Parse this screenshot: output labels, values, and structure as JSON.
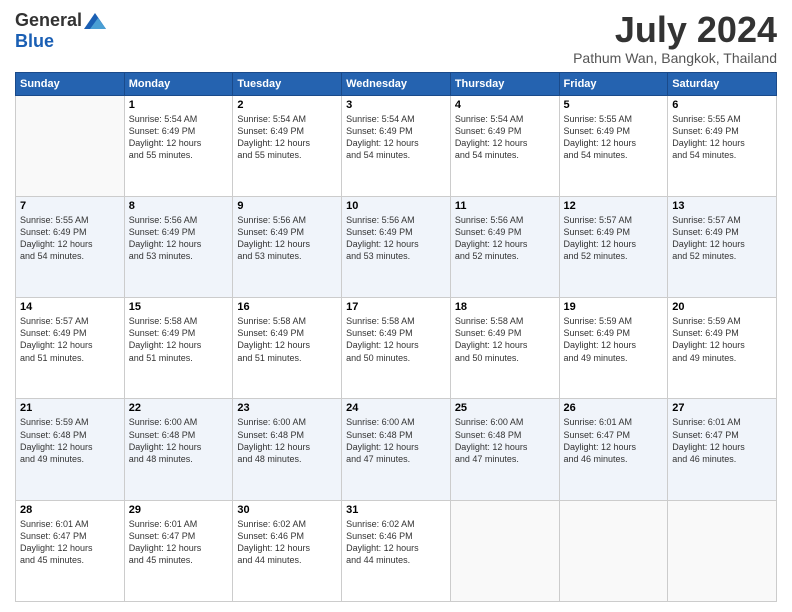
{
  "header": {
    "logo_general": "General",
    "logo_blue": "Blue",
    "title": "July 2024",
    "location": "Pathum Wan, Bangkok, Thailand"
  },
  "days_of_week": [
    "Sunday",
    "Monday",
    "Tuesday",
    "Wednesday",
    "Thursday",
    "Friday",
    "Saturday"
  ],
  "weeks": [
    [
      {
        "num": "",
        "empty": true
      },
      {
        "num": "1",
        "sunrise": "5:54 AM",
        "sunset": "6:49 PM",
        "daylight": "12 hours and 55 minutes."
      },
      {
        "num": "2",
        "sunrise": "5:54 AM",
        "sunset": "6:49 PM",
        "daylight": "12 hours and 55 minutes."
      },
      {
        "num": "3",
        "sunrise": "5:54 AM",
        "sunset": "6:49 PM",
        "daylight": "12 hours and 54 minutes."
      },
      {
        "num": "4",
        "sunrise": "5:54 AM",
        "sunset": "6:49 PM",
        "daylight": "12 hours and 54 minutes."
      },
      {
        "num": "5",
        "sunrise": "5:55 AM",
        "sunset": "6:49 PM",
        "daylight": "12 hours and 54 minutes."
      },
      {
        "num": "6",
        "sunrise": "5:55 AM",
        "sunset": "6:49 PM",
        "daylight": "12 hours and 54 minutes."
      }
    ],
    [
      {
        "num": "7",
        "sunrise": "5:55 AM",
        "sunset": "6:49 PM",
        "daylight": "12 hours and 54 minutes."
      },
      {
        "num": "8",
        "sunrise": "5:56 AM",
        "sunset": "6:49 PM",
        "daylight": "12 hours and 53 minutes."
      },
      {
        "num": "9",
        "sunrise": "5:56 AM",
        "sunset": "6:49 PM",
        "daylight": "12 hours and 53 minutes."
      },
      {
        "num": "10",
        "sunrise": "5:56 AM",
        "sunset": "6:49 PM",
        "daylight": "12 hours and 53 minutes."
      },
      {
        "num": "11",
        "sunrise": "5:56 AM",
        "sunset": "6:49 PM",
        "daylight": "12 hours and 52 minutes."
      },
      {
        "num": "12",
        "sunrise": "5:57 AM",
        "sunset": "6:49 PM",
        "daylight": "12 hours and 52 minutes."
      },
      {
        "num": "13",
        "sunrise": "5:57 AM",
        "sunset": "6:49 PM",
        "daylight": "12 hours and 52 minutes."
      }
    ],
    [
      {
        "num": "14",
        "sunrise": "5:57 AM",
        "sunset": "6:49 PM",
        "daylight": "12 hours and 51 minutes."
      },
      {
        "num": "15",
        "sunrise": "5:58 AM",
        "sunset": "6:49 PM",
        "daylight": "12 hours and 51 minutes."
      },
      {
        "num": "16",
        "sunrise": "5:58 AM",
        "sunset": "6:49 PM",
        "daylight": "12 hours and 51 minutes."
      },
      {
        "num": "17",
        "sunrise": "5:58 AM",
        "sunset": "6:49 PM",
        "daylight": "12 hours and 50 minutes."
      },
      {
        "num": "18",
        "sunrise": "5:58 AM",
        "sunset": "6:49 PM",
        "daylight": "12 hours and 50 minutes."
      },
      {
        "num": "19",
        "sunrise": "5:59 AM",
        "sunset": "6:49 PM",
        "daylight": "12 hours and 49 minutes."
      },
      {
        "num": "20",
        "sunrise": "5:59 AM",
        "sunset": "6:49 PM",
        "daylight": "12 hours and 49 minutes."
      }
    ],
    [
      {
        "num": "21",
        "sunrise": "5:59 AM",
        "sunset": "6:48 PM",
        "daylight": "12 hours and 49 minutes."
      },
      {
        "num": "22",
        "sunrise": "6:00 AM",
        "sunset": "6:48 PM",
        "daylight": "12 hours and 48 minutes."
      },
      {
        "num": "23",
        "sunrise": "6:00 AM",
        "sunset": "6:48 PM",
        "daylight": "12 hours and 48 minutes."
      },
      {
        "num": "24",
        "sunrise": "6:00 AM",
        "sunset": "6:48 PM",
        "daylight": "12 hours and 47 minutes."
      },
      {
        "num": "25",
        "sunrise": "6:00 AM",
        "sunset": "6:48 PM",
        "daylight": "12 hours and 47 minutes."
      },
      {
        "num": "26",
        "sunrise": "6:01 AM",
        "sunset": "6:47 PM",
        "daylight": "12 hours and 46 minutes."
      },
      {
        "num": "27",
        "sunrise": "6:01 AM",
        "sunset": "6:47 PM",
        "daylight": "12 hours and 46 minutes."
      }
    ],
    [
      {
        "num": "28",
        "sunrise": "6:01 AM",
        "sunset": "6:47 PM",
        "daylight": "12 hours and 45 minutes."
      },
      {
        "num": "29",
        "sunrise": "6:01 AM",
        "sunset": "6:47 PM",
        "daylight": "12 hours and 45 minutes."
      },
      {
        "num": "30",
        "sunrise": "6:02 AM",
        "sunset": "6:46 PM",
        "daylight": "12 hours and 44 minutes."
      },
      {
        "num": "31",
        "sunrise": "6:02 AM",
        "sunset": "6:46 PM",
        "daylight": "12 hours and 44 minutes."
      },
      {
        "num": "",
        "empty": true
      },
      {
        "num": "",
        "empty": true
      },
      {
        "num": "",
        "empty": true
      }
    ]
  ]
}
